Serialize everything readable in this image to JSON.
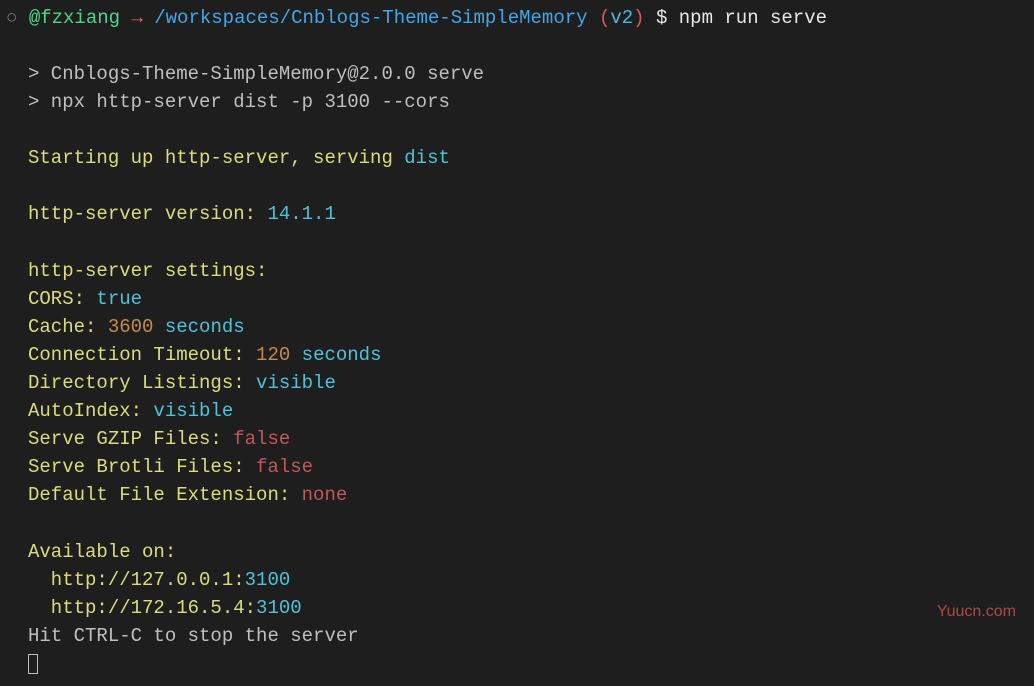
{
  "prompt": {
    "circle": "○",
    "user": "@fzxiang",
    "arrow": "→",
    "path": "/workspaces/Cnblogs-Theme-SimpleMemory",
    "paren_open": "(",
    "branch": "v2",
    "paren_close": ")",
    "dollar": "$",
    "command": "npm run serve"
  },
  "script_lines": [
    "> Cnblogs-Theme-SimpleMemory@2.0.0 serve",
    "> npx http-server dist -p 3100 --cors"
  ],
  "starting": {
    "prefix": "Starting up http-server, serving ",
    "dir": "dist"
  },
  "version": {
    "label": "http-server version: ",
    "value": "14.1.1"
  },
  "settings_header": "http-server settings:",
  "cors": {
    "label": "CORS: ",
    "value": "true"
  },
  "cache": {
    "label": "Cache: ",
    "num": "3600",
    "unit": " seconds"
  },
  "timeout": {
    "label": "Connection Timeout: ",
    "num": "120",
    "unit": " seconds"
  },
  "dir_listing": {
    "label": "Directory Listings: ",
    "value": "visible"
  },
  "autoindex": {
    "label": "AutoIndex: ",
    "value": "visible"
  },
  "gzip": {
    "label": "Serve GZIP Files: ",
    "value": "false"
  },
  "brotli": {
    "label": "Serve Brotli Files: ",
    "value": "false"
  },
  "default_ext": {
    "label": "Default File Extension: ",
    "value": "none"
  },
  "available_header": "Available on:",
  "urls": [
    {
      "prefix": "  http://127.0.0.1:",
      "port": "3100"
    },
    {
      "prefix": "  http://172.16.5.4:",
      "port": "3100"
    }
  ],
  "stop_hint": "Hit CTRL-C to stop the server",
  "watermark": "Yuucn.com"
}
